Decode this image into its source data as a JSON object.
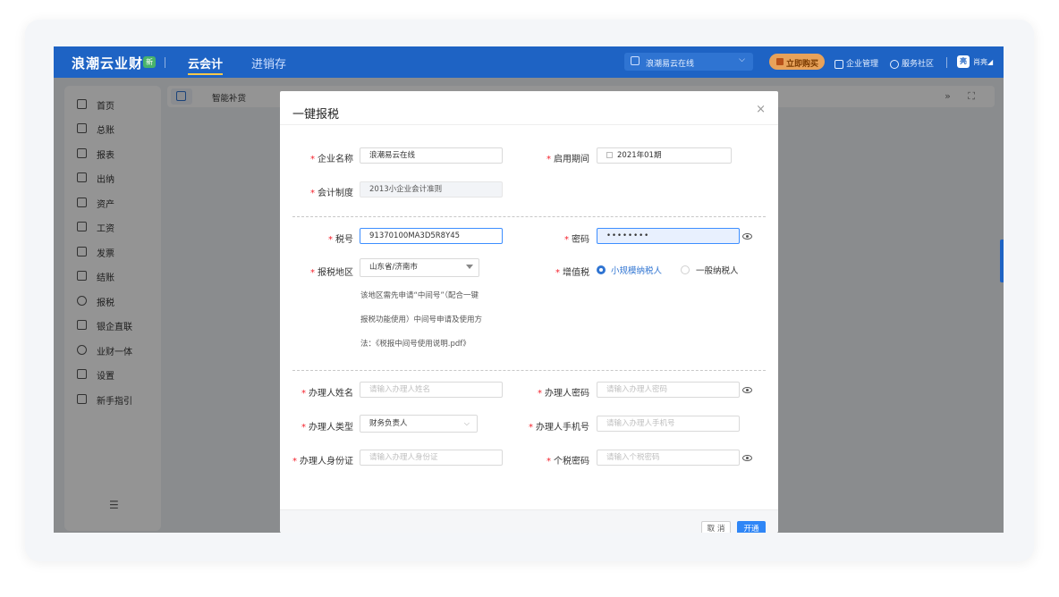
{
  "header": {
    "brand": "浪潮云业财",
    "brand_badge": "新",
    "nav_active": "云会计",
    "nav_other": "进销存",
    "company": "浪潮易云在线",
    "buy": "立即购买",
    "enterprise_mgmt": "企业管理",
    "community": "服务社区",
    "avatar": "亮",
    "user": "肖亮◢"
  },
  "sidebar": {
    "items": [
      {
        "label": "首页"
      },
      {
        "label": "总账"
      },
      {
        "label": "报表"
      },
      {
        "label": "出纳"
      },
      {
        "label": "资产"
      },
      {
        "label": "工资"
      },
      {
        "label": "发票"
      },
      {
        "label": "结账"
      },
      {
        "label": "报税"
      },
      {
        "label": "银企直联"
      },
      {
        "label": "业财一体"
      },
      {
        "label": "设置"
      },
      {
        "label": "新手指引"
      }
    ],
    "collapse_glyph": "☰"
  },
  "tabs": {
    "current": "智能补货",
    "tools": "» ⛶"
  },
  "modal": {
    "title": "一键报税",
    "close": "×",
    "required_mark": "*",
    "fields": {
      "company_name": {
        "label": "企业名称",
        "value": "浪潮易云在线"
      },
      "start_period": {
        "label": "启用期间",
        "value": "2021年01期"
      },
      "accounting_system": {
        "label": "会计制度",
        "value": "2013小企业会计准则"
      },
      "tax_no": {
        "label": "税号",
        "value": "91370100MA3D5R8Y45"
      },
      "password": {
        "label": "密码",
        "value": "••••••••"
      },
      "tax_region": {
        "label": "报税地区",
        "value": "山东省/济南市"
      },
      "vat": {
        "label": "增值税",
        "option_small": "小规模纳税人",
        "option_general": "一般纳税人"
      },
      "handler_name": {
        "label": "办理人姓名",
        "placeholder": "请输入办理人姓名"
      },
      "handler_password": {
        "label": "办理人密码",
        "placeholder": "请输入办理人密码"
      },
      "handler_type": {
        "label": "办理人类型",
        "value": "财务负责人"
      },
      "handler_phone": {
        "label": "办理人手机号",
        "placeholder": "请输入办理人手机号"
      },
      "handler_id": {
        "label": "办理人身份证",
        "placeholder": "请输入办理人身份证"
      },
      "personal_tax_password": {
        "label": "个税密码",
        "placeholder": "请输入个税密码"
      }
    },
    "region_note": [
      "该地区需先申请“中间号”（配合一键",
      "报税功能使用）中间号申请及使用方",
      "法：《税报中间号使用说明.pdf》"
    ],
    "cancel": "取 消",
    "submit": "开通"
  },
  "colors": {
    "primary": "#1e63c4",
    "accent_blue": "#2f86f6",
    "required": "#f5222d",
    "buy_orange": "#e8a25a"
  }
}
